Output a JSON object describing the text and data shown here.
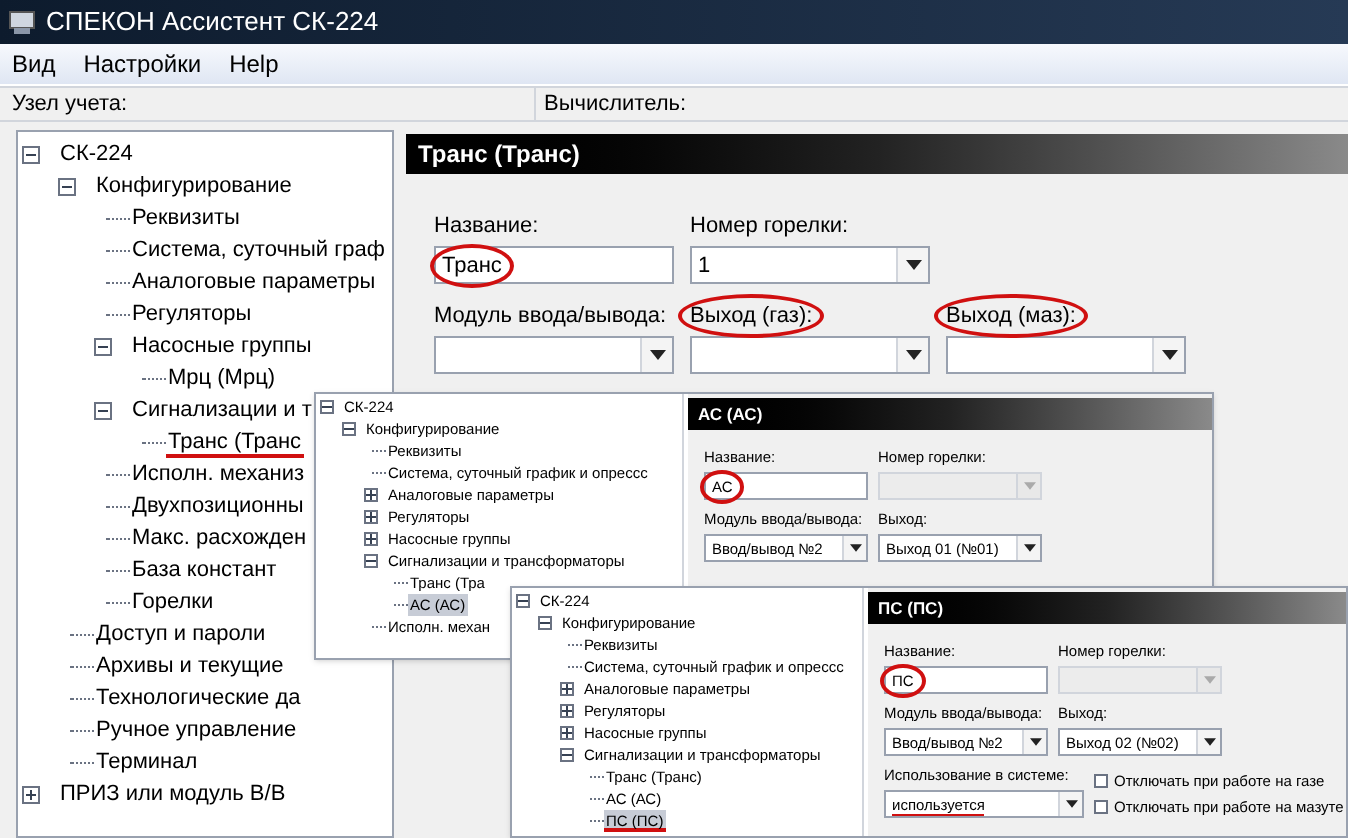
{
  "window": {
    "title": "СПЕКОН Ассистент СК-224"
  },
  "menu": [
    {
      "label": "Вид"
    },
    {
      "label": "Настройки"
    },
    {
      "label": "Help"
    }
  ],
  "info_bar": {
    "node_label": "Узел учета:",
    "calculator_label": "Вычислитель:"
  },
  "main": {
    "tree": [
      {
        "label": "СК-224",
        "expanded": true,
        "selected": false,
        "underlined": false,
        "children": [
          {
            "label": "Конфигурирование",
            "expanded": true,
            "selected": false,
            "underlined": false,
            "children": [
              {
                "label": "Реквизиты",
                "selected": false,
                "underlined": false
              },
              {
                "label": "Система, суточный граф",
                "selected": false,
                "underlined": false
              },
              {
                "label": "Аналоговые параметры",
                "selected": false,
                "underlined": false
              },
              {
                "label": "Регуляторы",
                "selected": false,
                "underlined": false
              },
              {
                "label": "Насосные группы",
                "expanded": true,
                "selected": false,
                "underlined": false,
                "children": [
                  {
                    "label": "Мрц (Мрц)",
                    "selected": false,
                    "underlined": false
                  }
                ]
              },
              {
                "label": "Сигнализации и т",
                "expanded": true,
                "selected": false,
                "underlined": false,
                "children": [
                  {
                    "label": "Транс (Транс",
                    "selected": false,
                    "underlined": true
                  }
                ]
              },
              {
                "label": "Исполн. механиз",
                "selected": false,
                "underlined": false
              },
              {
                "label": "Двухпозиционны",
                "selected": false,
                "underlined": false
              },
              {
                "label": "Макс. расхожден",
                "selected": false,
                "underlined": false
              },
              {
                "label": "База констант",
                "selected": false,
                "underlined": false
              },
              {
                "label": "Горелки",
                "selected": false,
                "underlined": false
              }
            ]
          },
          {
            "label": "Доступ и пароли",
            "selected": false,
            "underlined": false
          },
          {
            "label": "Архивы и текущие",
            "selected": false,
            "underlined": false
          },
          {
            "label": "Технологические да",
            "selected": false,
            "underlined": false
          },
          {
            "label": "Ручное управление",
            "selected": false,
            "underlined": false
          },
          {
            "label": "Терминал",
            "selected": false,
            "underlined": false
          }
        ]
      },
      {
        "label": "ПРИЗ или модуль В/В",
        "expanded": false,
        "selected": false,
        "underlined": false
      }
    ],
    "panel": {
      "title": "Транс (Транс)",
      "rows": [
        [
          {
            "kind": "text",
            "label": "Название:",
            "value": "Транс",
            "label_circled": false,
            "value_circled": true
          },
          {
            "kind": "select",
            "label": "Номер горелки:",
            "value": "1",
            "disabled": false,
            "label_circled": false,
            "value_circled": false
          }
        ],
        [
          {
            "kind": "select",
            "label": "Модуль ввода/вывода:",
            "disabled": false,
            "label_circled": false
          },
          {
            "kind": "select",
            "label": "Выход (газ):",
            "disabled": false,
            "label_circled": true
          },
          {
            "kind": "select",
            "label": "Выход (маз):",
            "disabled": false,
            "label_circled": true
          }
        ]
      ]
    }
  },
  "overlays": [
    {
      "tree": [
        {
          "label": "СК-224",
          "expanded": true,
          "selected": false,
          "underlined": false,
          "children": [
            {
              "label": "Конфигурирование",
              "expanded": true,
              "selected": false,
              "underlined": false,
              "children": [
                {
                  "label": "Реквизиты",
                  "selected": false,
                  "underlined": false
                },
                {
                  "label": "Система, суточный график и опрессс",
                  "selected": false,
                  "underlined": false
                },
                {
                  "label": "Аналоговые параметры",
                  "expanded": false,
                  "selected": false,
                  "underlined": false
                },
                {
                  "label": "Регуляторы",
                  "expanded": false,
                  "selected": false,
                  "underlined": false
                },
                {
                  "label": "Насосные группы",
                  "expanded": false,
                  "selected": false,
                  "underlined": false
                },
                {
                  "label": "Сигнализации и трансформаторы",
                  "expanded": true,
                  "selected": false,
                  "underlined": false,
                  "children": [
                    {
                      "label": "Транс (Тра",
                      "selected": false,
                      "underlined": false
                    },
                    {
                      "label": "АС (АС)",
                      "selected": true,
                      "underlined": false
                    }
                  ]
                },
                {
                  "label": "Исполн. механ",
                  "selected": false,
                  "underlined": false
                }
              ]
            }
          ]
        }
      ],
      "panel": {
        "title": "АС (АС)",
        "rows": [
          [
            {
              "kind": "text",
              "label": "Название:",
              "value": "АС",
              "label_circled": false,
              "value_circled": true
            },
            {
              "kind": "select",
              "label": "Номер горелки:",
              "disabled": true,
              "label_circled": false
            }
          ],
          [
            {
              "kind": "select",
              "label": "Модуль ввода/вывода:",
              "value": "Ввод/вывод №2",
              "disabled": false,
              "label_circled": false,
              "value_circled": false
            },
            {
              "kind": "select",
              "label": "Выход:",
              "value": "Выход 01 (№01)",
              "disabled": false,
              "label_circled": false,
              "value_circled": false
            }
          ]
        ]
      }
    },
    {
      "tree": [
        {
          "label": "СК-224",
          "expanded": true,
          "selected": false,
          "underlined": false,
          "children": [
            {
              "label": "Конфигурирование",
              "expanded": true,
              "selected": false,
              "underlined": false,
              "children": [
                {
                  "label": "Реквизиты",
                  "selected": false,
                  "underlined": false
                },
                {
                  "label": "Система, суточный график и опрессс",
                  "selected": false,
                  "underlined": false
                },
                {
                  "label": "Аналоговые параметры",
                  "expanded": false,
                  "selected": false,
                  "underlined": false
                },
                {
                  "label": "Регуляторы",
                  "expanded": false,
                  "selected": false,
                  "underlined": false
                },
                {
                  "label": "Насосные группы",
                  "expanded": false,
                  "selected": false,
                  "underlined": false
                },
                {
                  "label": "Сигнализации и трансформаторы",
                  "expanded": true,
                  "selected": false,
                  "underlined": false,
                  "children": [
                    {
                      "label": "Транс (Транс)",
                      "selected": false,
                      "underlined": false
                    },
                    {
                      "label": "АС (АС)",
                      "selected": false,
                      "underlined": false
                    },
                    {
                      "label": "ПС (ПС)",
                      "selected": true,
                      "underlined": true
                    }
                  ]
                }
              ]
            }
          ]
        }
      ],
      "panel": {
        "title": "ПС (ПС)",
        "rows": [
          [
            {
              "kind": "text",
              "label": "Название:",
              "value": "ПС",
              "label_circled": false,
              "value_circled": true
            },
            {
              "kind": "select",
              "label": "Номер горелки:",
              "disabled": true,
              "label_circled": false
            }
          ],
          [
            {
              "kind": "select",
              "label": "Модуль ввода/вывода:",
              "value": "Ввод/вывод №2",
              "disabled": false,
              "label_circled": false,
              "value_circled": false
            },
            {
              "kind": "select",
              "label": "Выход:",
              "value": "Выход 02 (№02)",
              "disabled": false,
              "label_circled": false,
              "value_circled": false
            }
          ],
          [
            {
              "kind": "select",
              "label": "Использование в системе:",
              "value": "используется",
              "disabled": false,
              "underlined": true,
              "label_circled": false,
              "value_circled": false
            },
            {
              "kind": "checks",
              "items": [
                {
                  "label": "Отключать при работе на газе",
                  "checked": false
                },
                {
                  "label": "Отключать при работе на мазуте",
                  "checked": false
                }
              ]
            }
          ]
        ]
      }
    }
  ]
}
